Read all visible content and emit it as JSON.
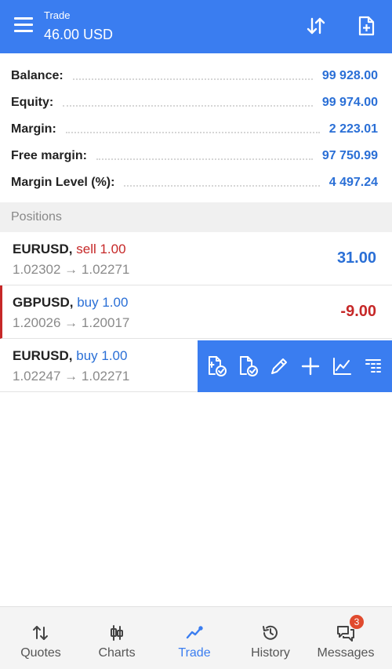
{
  "header": {
    "screen_title": "Trade",
    "balance_display": "46.00 USD"
  },
  "summary": [
    {
      "label": "Balance:",
      "value": "99 928.00"
    },
    {
      "label": "Equity:",
      "value": "99 974.00"
    },
    {
      "label": "Margin:",
      "value": "2 223.01"
    },
    {
      "label": "Free margin:",
      "value": "97 750.99"
    },
    {
      "label": "Margin Level (%):",
      "value": "4 497.24"
    }
  ],
  "positions_header": "Positions",
  "positions": [
    {
      "symbol": "EURUSD,",
      "side": "sell 1.00",
      "prices": "1.02302 → 1.02271",
      "profit": "31.00"
    },
    {
      "symbol": "GBPUSD,",
      "side": "buy 1.00",
      "prices": "1.20026 → 1.20017",
      "profit": "-9.00"
    },
    {
      "symbol": "EURUSD,",
      "side": "buy 1.00",
      "prices": "1.02247 → 1.02271",
      "profit": ""
    }
  ],
  "action_icons": [
    "close-position-icon",
    "close-order-icon",
    "edit-icon",
    "new-order-icon",
    "chart-icon",
    "depth-icon"
  ],
  "nav": {
    "items": [
      {
        "label": "Quotes",
        "icon": "quotes-icon"
      },
      {
        "label": "Charts",
        "icon": "charts-icon"
      },
      {
        "label": "Trade",
        "icon": "trade-icon"
      },
      {
        "label": "History",
        "icon": "history-icon"
      },
      {
        "label": "Messages",
        "icon": "messages-icon"
      }
    ],
    "messages_badge": "3",
    "active_item": "Trade"
  },
  "colors": {
    "accent": "#3a7df0",
    "profit_positive": "#2a6fd6",
    "profit_negative": "#c62828"
  }
}
